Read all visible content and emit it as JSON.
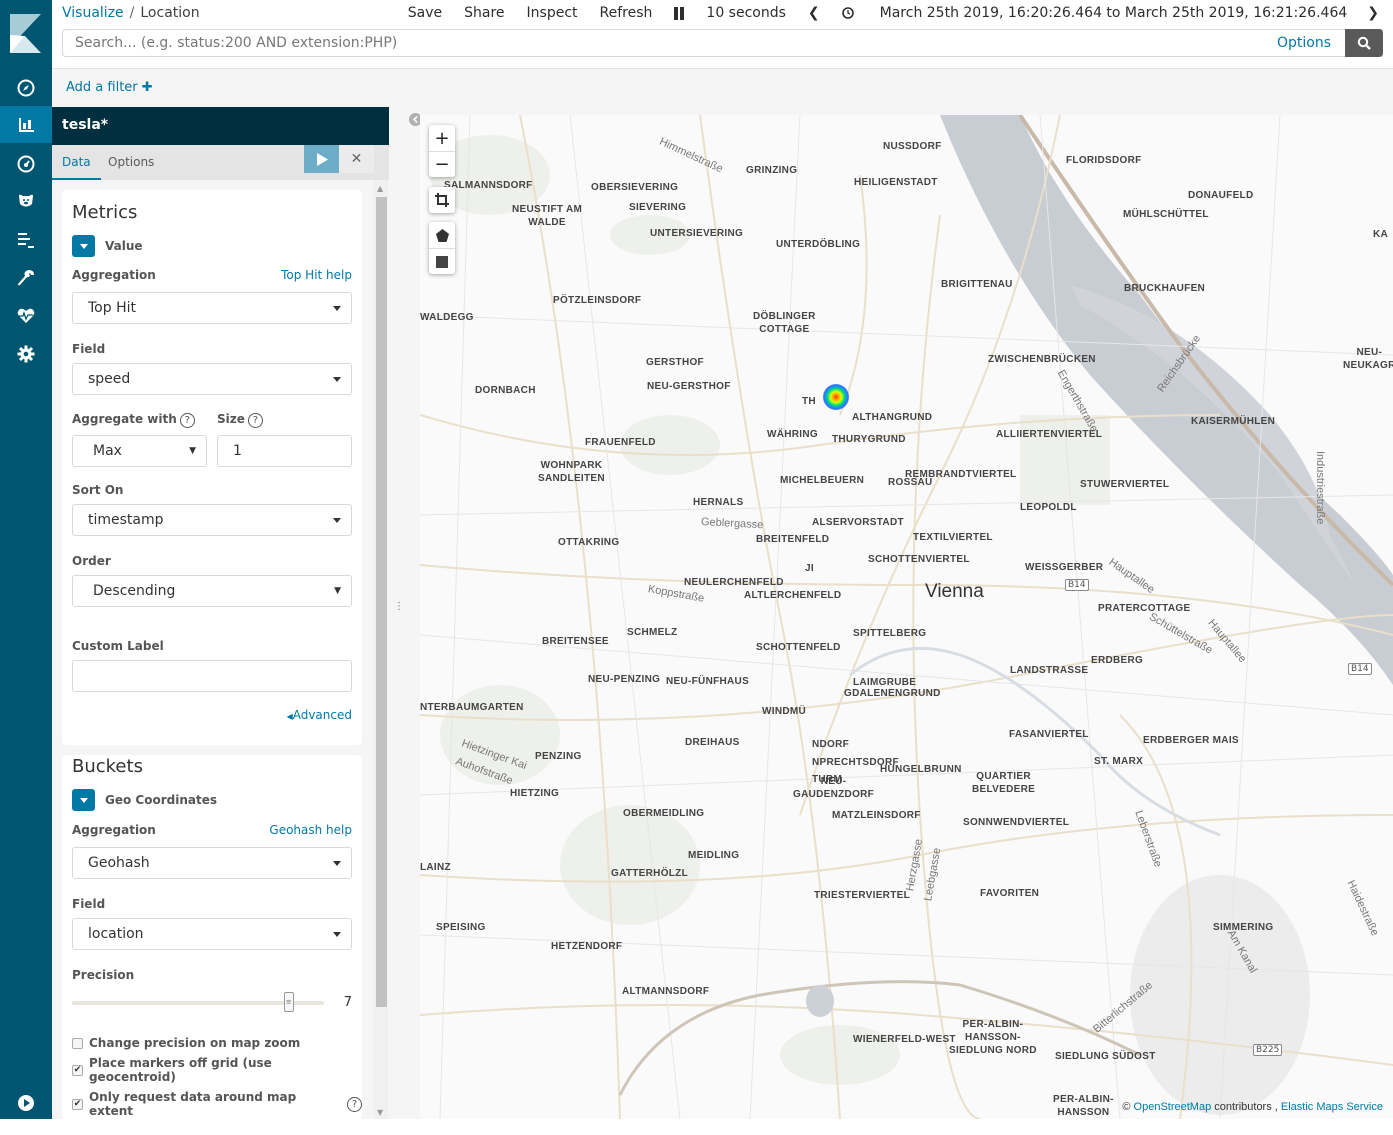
{
  "nav": {
    "items": [
      {
        "name": "discover",
        "icon": "compass-icon"
      },
      {
        "name": "visualize",
        "icon": "bar-chart-icon",
        "active": true
      },
      {
        "name": "dashboard",
        "icon": "dashboard-gauge-icon"
      },
      {
        "name": "canvas",
        "icon": "bear-icon"
      },
      {
        "name": "logs",
        "icon": "log-lines-icon"
      },
      {
        "name": "dev-tools",
        "icon": "wrench-icon"
      },
      {
        "name": "monitoring",
        "icon": "heartbeat-icon"
      },
      {
        "name": "management",
        "icon": "gear-icon"
      }
    ],
    "bottom_icon": "play-circle-icon"
  },
  "header": {
    "breadcrumb_root": "Visualize",
    "breadcrumb_sep": "/",
    "breadcrumb_current": "Location",
    "menu": {
      "save": "Save",
      "share": "Share",
      "inspect": "Inspect",
      "refresh": "Refresh",
      "interval": "10 seconds",
      "prev": "❮",
      "next": "❯",
      "time_range": "March 25th 2019, 16:20:26.464 to March 25th 2019, 16:21:26.464"
    },
    "search": {
      "placeholder": "Search... (e.g. status:200 AND extension:PHP)",
      "value": "",
      "options": "Options"
    }
  },
  "filter": {
    "add_label": "Add a filter"
  },
  "sidebar": {
    "index_pattern": "tesla*",
    "tabs": [
      "Data",
      "Options"
    ],
    "metrics": {
      "title": "Metrics",
      "agg_title": "Value",
      "aggregation_label": "Aggregation",
      "aggregation_help": "Top Hit help",
      "aggregation_value": "Top Hit",
      "field_label": "Field",
      "field_value": "speed",
      "aggregate_with_label": "Aggregate with",
      "aggregate_with_value": "Max",
      "size_label": "Size",
      "size_value": "1",
      "sort_on_label": "Sort On",
      "sort_on_value": "timestamp",
      "order_label": "Order",
      "order_value": "Descending",
      "custom_label_label": "Custom Label",
      "custom_label_value": "",
      "advanced": "Advanced"
    },
    "buckets": {
      "title": "Buckets",
      "agg_title": "Geo Coordinates",
      "aggregation_label": "Aggregation",
      "aggregation_help": "Geohash help",
      "aggregation_value": "Geohash",
      "field_label": "Field",
      "field_value": "location",
      "precision_label": "Precision",
      "precision_value": "7",
      "precision_fraction": 0.86,
      "checkboxes": [
        {
          "label": "Change precision on map zoom",
          "checked": false
        },
        {
          "label": "Place markers off grid (use geocentroid)",
          "checked": true
        },
        {
          "label": "Only request data around map extent",
          "checked": true
        }
      ]
    }
  },
  "map": {
    "city": "Vienna",
    "places": [
      "NUSSDORF",
      "FLORIDSDORF",
      "GRINZING",
      "HEILIGENSTADT",
      "DONAUFELD",
      "SALMANNSDORF",
      "OBERSIEVERING",
      "MÜHLSCHÜTTEL",
      "NEUSTIFT AM\nWALDE",
      "SIEVERING",
      "UNTERSIEVERING",
      "KA",
      "UNTERDÖBLING",
      "BRIGITTENAU",
      "BRUCKHAUFEN",
      "PÖTZLEINSDORF",
      "WALDEGG",
      "DÖBLINGER\nCOTTAGE",
      "GERSTHOF",
      "ZWISCHENBRÜCKEN",
      "NEU-\nNEUKAGR",
      "NEU-GERSTHOF",
      "DORNBACH",
      "TH",
      "ALTHANGRUND",
      "KAISERMÜHLEN",
      "WÄHRING",
      "THURYGRUND",
      "ALLIIERTENVIERTEL",
      "FRAUENFELD",
      "REMBRANDTVIERTEL",
      "WOHNPARK\nSANDLEITEN",
      "MICHELBEUERN",
      "ROSSAU",
      "STUWERVIERTEL",
      "HERNALS",
      "LEOPOLDL",
      "ALSERVORSTADT",
      "TEXTILVIERTEL",
      "BREITENFELD",
      "OTTAKRING",
      "SCHOTTENVIERTEL",
      "WEISSGERBER",
      "JI",
      "NEULERCHENFELD",
      "ALTLERCHENFELD",
      "PRATERCOTTAGE",
      "SCHMELZ",
      "SPITTELBERG",
      "BREITENSEE",
      "SCHOTTENFELD",
      "ERDBERG",
      "LANDSTRASSE",
      "NEU-PENZING",
      "NEU-FÜNFHAUS",
      "LAIMGRUBE",
      "GDALENENGRUND",
      "NTERBAUMGARTEN",
      "WINDMÜ",
      "DREIHAUS",
      "NDORF",
      "FASANVIERTEL",
      "NPRECHTSDORF",
      "ERDBERGER MAIS",
      "PENZING",
      "HUNGELBRUNN",
      "ST. MARX",
      "TURM",
      "QUARTIER\nBELVEDERE",
      "HIETZING",
      "NEU-\nGAUDENZDORF",
      "OBERMEIDLING",
      "MATZLEINSDORF",
      "SONNWENDVIERTEL",
      "MEIDLING",
      "LAINZ",
      "GATTERHÖLZL",
      "FAVORITEN",
      "TRIESTERVIERTEL",
      "SPEISING",
      "SIMMERING",
      "HETZENDORF",
      "ALTMANNSDORF",
      "WIENERFELD-WEST",
      "PER-ALBIN-\nHANSSON-\nSIEDLUNG NORD",
      "SIEDLUNG SÜDOST",
      "PER-ALBIN-\nHANSSON"
    ],
    "streets": [
      "Himmelstraße",
      "Engerthstraße",
      "Reichsbrücke",
      "Industriestraße",
      "Geblergasse",
      "Hauptallee",
      "Hauptallee",
      "Koppstraße",
      "Schüttelstraße",
      "Hietzinger Kai",
      "Auhofstraße",
      "Leberstraße",
      "Herzgasse",
      "Leebgasse",
      "Haidestraße",
      "Am Kanal",
      "Bitterlichstraße"
    ],
    "shields": [
      "B14",
      "B14",
      "B225"
    ],
    "controls": {
      "zoom_in": "+",
      "zoom_out": "−"
    },
    "attribution": {
      "prefix": "©",
      "osm": "OpenStreetMap",
      "contributors": "contributors ,",
      "ems": "Elastic Maps Service"
    }
  },
  "colors": {
    "nav_bg": "#005571",
    "nav_active": "#0079a5",
    "accent": "#0079a5",
    "index_bar": "#00303f",
    "apply_btn": "#6eadc8"
  }
}
